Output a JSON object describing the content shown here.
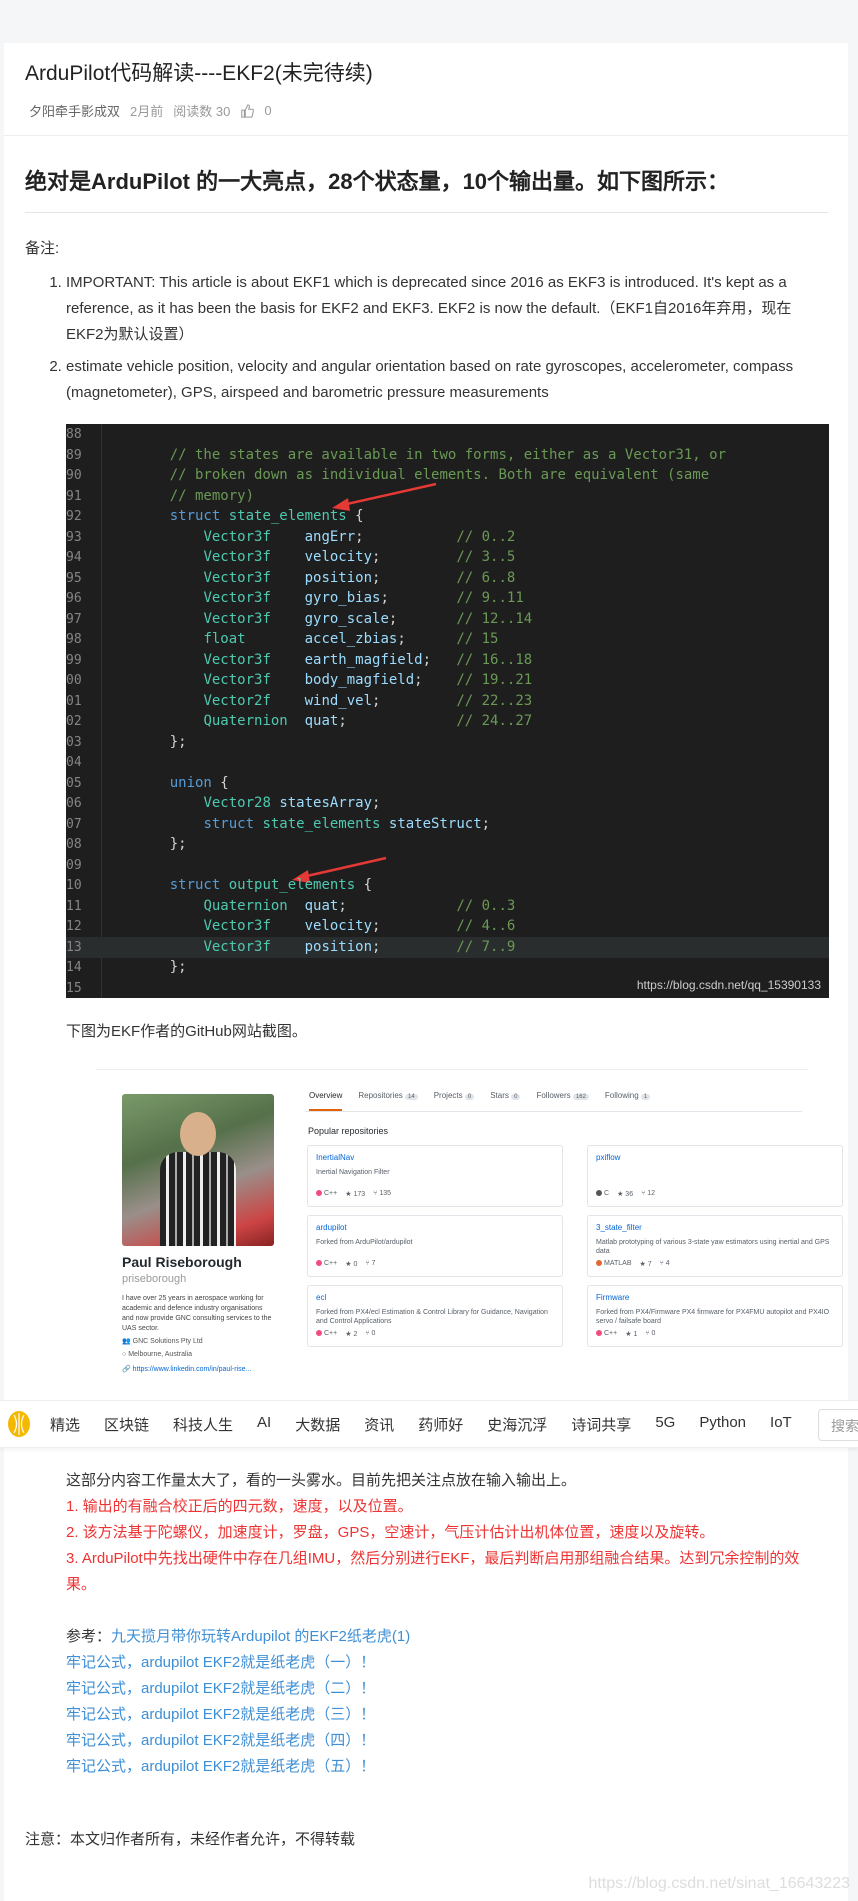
{
  "article": {
    "title": "ArduPilot代码解读----EKF2(未完待续)",
    "author": "夕阳牵手影成双",
    "time": "2月前",
    "reads": "阅读数 30",
    "likes": "0",
    "headline": "绝对是ArduPilot 的一大亮点，28个状态量，10个输出量。如下图所示：",
    "note_label": "备注:",
    "notes": [
      "IMPORTANT: This article is about EKF1 which is deprecated since 2016 as EKF3 is introduced. It's kept as a reference, as it has been the basis for EKF2 and EKF3. EKF2 is now the default.（EKF1自2016年弃用，现在EKF2为默认设置）",
      "estimate vehicle position, velocity and angular orientation based on rate gyroscopes, accelerometer, compass (magnetometer), GPS, airspeed and barometric pressure measurements"
    ],
    "code_watermark": "https://blog.csdn.net/qq_15390133",
    "github_caption": "下图为EKF作者的GitHub网站截图。"
  },
  "code": {
    "lines": [
      {
        "n": "88",
        "t": ""
      },
      {
        "n": "89",
        "t": "    // the states are available in two forms, either as a Vector31, or"
      },
      {
        "n": "90",
        "t": "    // broken down as individual elements. Both are equivalent (same"
      },
      {
        "n": "91",
        "t": "    // memory)"
      },
      {
        "n": "92",
        "t": "    struct state_elements {"
      },
      {
        "n": "93",
        "t": "        Vector3f    angErr;           // 0..2"
      },
      {
        "n": "94",
        "t": "        Vector3f    velocity;         // 3..5"
      },
      {
        "n": "95",
        "t": "        Vector3f    position;         // 6..8"
      },
      {
        "n": "96",
        "t": "        Vector3f    gyro_bias;        // 9..11"
      },
      {
        "n": "97",
        "t": "        Vector3f    gyro_scale;       // 12..14"
      },
      {
        "n": "98",
        "t": "        float       accel_zbias;      // 15"
      },
      {
        "n": "99",
        "t": "        Vector3f    earth_magfield;   // 16..18"
      },
      {
        "n": "00",
        "t": "        Vector3f    body_magfield;    // 19..21"
      },
      {
        "n": "01",
        "t": "        Vector2f    wind_vel;         // 22..23"
      },
      {
        "n": "02",
        "t": "        Quaternion  quat;             // 24..27"
      },
      {
        "n": "03",
        "t": "    };"
      },
      {
        "n": "04",
        "t": ""
      },
      {
        "n": "05",
        "t": "    union {"
      },
      {
        "n": "06",
        "t": "        Vector28 statesArray;"
      },
      {
        "n": "07",
        "t": "        struct state_elements stateStruct;"
      },
      {
        "n": "08",
        "t": "    };"
      },
      {
        "n": "09",
        "t": ""
      },
      {
        "n": "10",
        "t": "    struct output_elements {"
      },
      {
        "n": "11",
        "t": "        Quaternion  quat;             // 0..3"
      },
      {
        "n": "12",
        "t": "        Vector3f    velocity;         // 4..6"
      },
      {
        "n": "13",
        "t": "        Vector3f    position;         // 7..9"
      },
      {
        "n": "14",
        "t": "    };"
      },
      {
        "n": "15",
        "t": ""
      }
    ]
  },
  "github": {
    "name": "Paul Riseborough",
    "username": "priseborough",
    "bio": "I have over 25 years in aerospace working for academic and defence industry organisations and now provide GNC consulting services to the UAS sector.",
    "company": "GNC Solutions Pty Ltd",
    "location": "Melbourne, Australia",
    "link": "https://www.linkedin.com/in/paul-rise...",
    "tabs": [
      {
        "label": "Overview",
        "count": ""
      },
      {
        "label": "Repositories",
        "count": "14"
      },
      {
        "label": "Projects",
        "count": "0"
      },
      {
        "label": "Stars",
        "count": "0"
      },
      {
        "label": "Followers",
        "count": "162"
      },
      {
        "label": "Following",
        "count": "1"
      }
    ],
    "popular_label": "Popular repositories",
    "repos": [
      {
        "name": "InertialNav",
        "desc": "Inertial Navigation Filter",
        "lang": "C++",
        "color": "#f34b7d",
        "stars": "173",
        "forks": "135"
      },
      {
        "name": "pxiflow",
        "desc": "",
        "lang": "C",
        "color": "#555555",
        "stars": "36",
        "forks": "12"
      },
      {
        "name": "ardupilot",
        "desc": "Forked from ArduPilot/ardupilot",
        "lang": "C++",
        "color": "#f34b7d",
        "stars": "0",
        "forks": "7"
      },
      {
        "name": "3_state_filter",
        "desc": "Matlab prototyping of various 3-state yaw estimators using inertial and GPS data",
        "lang": "MATLAB",
        "color": "#e16737",
        "stars": "7",
        "forks": "4"
      },
      {
        "name": "ecl",
        "desc": "Forked from PX4/ecl  Estimation & Control Library for Guidance, Navigation and Control Applications",
        "lang": "C++",
        "color": "#f34b7d",
        "stars": "2",
        "forks": "0"
      },
      {
        "name": "Firmware",
        "desc": "Forked from PX4/Firmware  PX4 firmware for PX4FMU autopilot and PX4IO servo / failsafe board",
        "lang": "C++",
        "color": "#f34b7d",
        "stars": "1",
        "forks": "0"
      }
    ]
  },
  "nav": {
    "items": [
      "精选",
      "区块链",
      "科技人生",
      "AI",
      "大数据",
      "资讯",
      "药师好",
      "史海沉浮",
      "诗词共享",
      "5G",
      "Python",
      "IoT"
    ],
    "search": "搜索"
  },
  "lower": {
    "intro": "这部分内容工作量太大了，看的一头雾水。目前先把关注点放在输入输出上。",
    "red_points": [
      "1. 输出的有融合校正后的四元数，速度，以及位置。",
      "2. 该方法基于陀螺仪，加速度计，罗盘，GPS，空速计，气压计估计出机体位置，速度以及旋转。",
      "3. ArduPilot中先找出硬件中存在几组IMU，然后分别进行EKF，最后判断启用那组融合结果。达到冗余控制的效果。"
    ],
    "ref_label": "参考：",
    "refs": [
      "九天揽月带你玩转Ardupilot 的EKF2纸老虎(1)",
      "牢记公式，ardupilot EKF2就是纸老虎（一）！",
      "牢记公式，ardupilot EKF2就是纸老虎（二）！",
      "牢记公式，ardupilot EKF2就是纸老虎（三）！",
      "牢记公式，ardupilot EKF2就是纸老虎（四）！",
      "牢记公式，ardupilot EKF2就是纸老虎（五）！"
    ],
    "notice": "注意：本文归作者所有，未经作者允许，不得转载",
    "page_watermark": "https://blog.csdn.net/sinat_16643223"
  }
}
